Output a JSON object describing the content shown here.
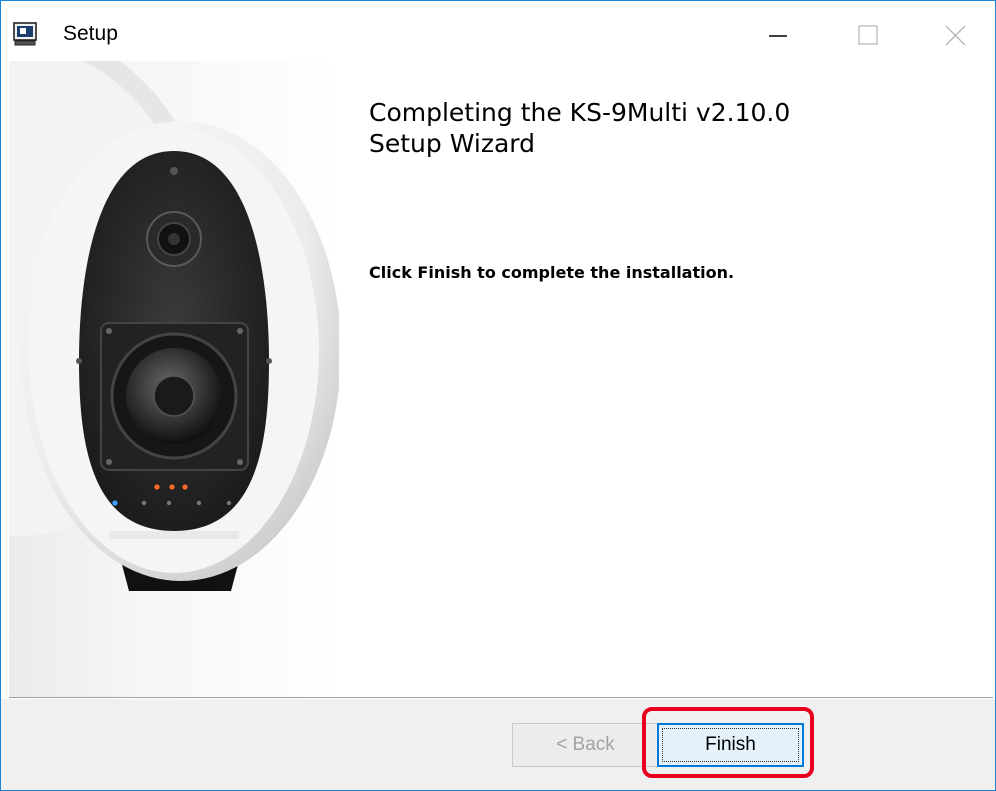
{
  "window": {
    "title": "Setup",
    "icon": "setup-app-icon",
    "controls": [
      "minimize-icon",
      "maximize-icon",
      "close-icon"
    ]
  },
  "banner": {
    "image": "speaker-product-image"
  },
  "content": {
    "heading": "Completing the KS-9Multi v2.10.0\nSetup Wizard",
    "message": "Click Finish to complete the installation."
  },
  "buttons": {
    "back_label": "< Back",
    "finish_label": "Finish"
  },
  "colors": {
    "window_border": "#1883d7",
    "footer_bg": "#f0f0f0",
    "focus_border": "#0078d7",
    "highlight": "#e8001c"
  }
}
